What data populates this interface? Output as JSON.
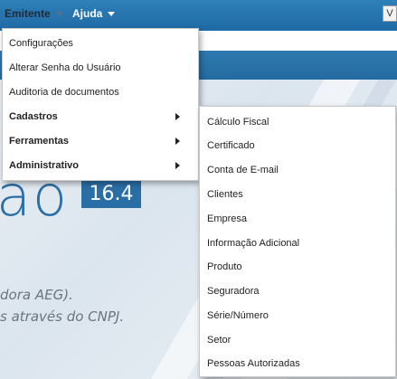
{
  "menubar": {
    "emitente": "Emitente",
    "ajuda": "Ajuda",
    "right_glyph": "V"
  },
  "background": {
    "big_text": "ao",
    "version": "16.4",
    "line1": "dora AEG).",
    "line2": "s através do CNPJ."
  },
  "emitente_menu": {
    "items": [
      {
        "label": "Configurações",
        "submenu": false,
        "bold": false
      },
      {
        "label": "Alterar Senha do Usuário",
        "submenu": false,
        "bold": false
      },
      {
        "label": "Auditoria de documentos",
        "submenu": false,
        "bold": false
      },
      {
        "label": "Cadastros",
        "submenu": true,
        "bold": true
      },
      {
        "label": "Ferramentas",
        "submenu": true,
        "bold": true
      },
      {
        "label": "Administrativo",
        "submenu": true,
        "bold": true
      }
    ]
  },
  "cadastros_submenu": {
    "items": [
      "Cálculo Fiscal",
      "Certificado",
      "Conta de E-mail",
      "Clientes",
      "Empresa",
      "Informação Adicional",
      "Produto",
      "Seguradora",
      "Série/Número",
      "Setor",
      "Pessoas Autorizadas"
    ]
  }
}
